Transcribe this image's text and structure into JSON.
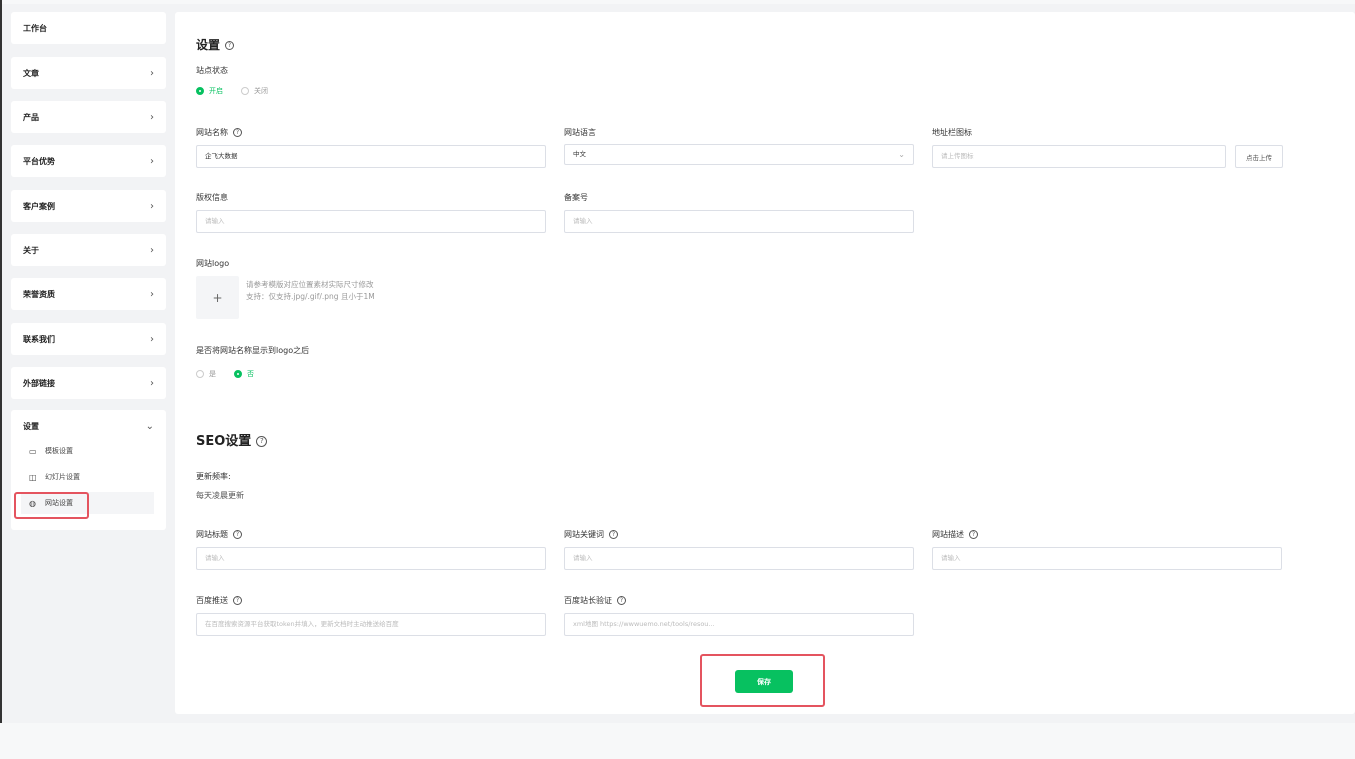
{
  "sidebar": {
    "items": [
      {
        "label": "工作台",
        "chevron": ""
      },
      {
        "label": "文章",
        "chevron": "›"
      },
      {
        "label": "产品",
        "chevron": "›"
      },
      {
        "label": "平台优势",
        "chevron": "›"
      },
      {
        "label": "客户案例",
        "chevron": "›"
      },
      {
        "label": "关于",
        "chevron": "›"
      },
      {
        "label": "荣誉资质",
        "chevron": "›"
      },
      {
        "label": "联系我们",
        "chevron": "›"
      },
      {
        "label": "外部链接",
        "chevron": "›"
      }
    ],
    "settings": {
      "label": "设置",
      "chevron": "⌄",
      "children": [
        {
          "label": "模板设置",
          "icon": "monitor-icon",
          "glyph": "▭"
        },
        {
          "label": "幻灯片设置",
          "icon": "slides-icon",
          "glyph": "◫"
        },
        {
          "label": "网站设置",
          "icon": "globe-icon",
          "glyph": "◍",
          "active": true
        }
      ]
    }
  },
  "main": {
    "title": "设置",
    "help_glyph": "?",
    "site_status": {
      "label": "站点状态",
      "options": [
        {
          "label": "开启",
          "selected": true
        },
        {
          "label": "关闭",
          "selected": false
        }
      ]
    },
    "site_name": {
      "label": "网站名称",
      "value": "企飞大数据"
    },
    "site_language": {
      "label": "网站语言",
      "value": "中文",
      "arrow": "⌄"
    },
    "favicon": {
      "label": "地址栏图标",
      "placeholder": "请上传图标",
      "button": "点击上传"
    },
    "copyright": {
      "label": "版权信息",
      "placeholder": "请输入"
    },
    "icp": {
      "label": "备案号",
      "placeholder": "请输入"
    },
    "logo": {
      "label": "网站logo",
      "plus": "+",
      "hint1": "请参考模版对应位置素材实际尺寸修改",
      "hint2": "支持：仅支持.jpg/.gif/.png 且小于1M"
    },
    "show_name_after_logo": {
      "label": "是否将网站名称显示到logo之后",
      "options": [
        {
          "label": "是",
          "selected": false
        },
        {
          "label": "否",
          "selected": true
        }
      ]
    }
  },
  "seo": {
    "title": "SEO设置",
    "update_freq_label": "更新频率:",
    "update_freq_value": "每天凌晨更新",
    "site_title": {
      "label": "网站标题",
      "placeholder": "请输入"
    },
    "site_keywords": {
      "label": "网站关键词",
      "placeholder": "请输入"
    },
    "site_desc": {
      "label": "网站描述",
      "placeholder": "请输入"
    },
    "baidu_push": {
      "label": "百度推送",
      "placeholder": "在百度搜索资源平台获取token并填入，更新文档时主动推送给百度"
    },
    "baidu_verify": {
      "label": "百度站长验证",
      "placeholder": "xml地图 https://wwwuemo.net/tools/resou..."
    }
  },
  "actions": {
    "save_label": "保存"
  },
  "colors": {
    "accent": "#07c160",
    "highlight": "#e4545f"
  }
}
